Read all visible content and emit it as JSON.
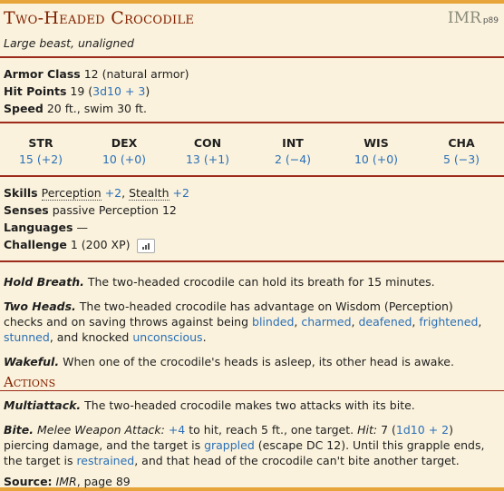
{
  "creature": {
    "name": "Two-Headed Crocodile",
    "source_abbr": "IMR",
    "source_page": "p89",
    "type_line": "Large beast, unaligned"
  },
  "stats": {
    "ac_label": "Armor Class",
    "ac_value": "12 (natural armor)",
    "hp_label": "Hit Points",
    "hp_value": "19 (",
    "hp_dice": "3d10 + 3",
    "hp_close": ")",
    "speed_label": "Speed",
    "speed_value": "20 ft., swim 30 ft."
  },
  "abilities": [
    {
      "name": "STR",
      "score": "15 (+2)"
    },
    {
      "name": "DEX",
      "score": "10 (+0)"
    },
    {
      "name": "CON",
      "score": "13 (+1)"
    },
    {
      "name": "INT",
      "score": "2 (−4)"
    },
    {
      "name": "WIS",
      "score": "10 (+0)"
    },
    {
      "name": "CHA",
      "score": "5 (−3)"
    }
  ],
  "details": {
    "skills_label": "Skills",
    "skill1": "Perception",
    "skill1_bonus": "+2",
    "skill2": "Stealth",
    "skill2_bonus": "+2",
    "senses_label": "Senses",
    "senses_value": "passive Perception 12",
    "languages_label": "Languages",
    "languages_value": "—",
    "challenge_label": "Challenge",
    "challenge_value": "1 (200 XP)"
  },
  "traits": {
    "hold_breath_name": "Hold Breath.",
    "hold_breath_text": "The two-headed crocodile can hold its breath for 15 minutes.",
    "two_heads_name": "Two Heads.",
    "two_heads_text1": "The two-headed crocodile has advantage on Wisdom (Perception) checks and on saving throws against being",
    "cond_blinded": "blinded",
    "cond_charmed": "charmed",
    "cond_deafened": "deafened",
    "cond_frightened": "frightened",
    "cond_stunned": "stunned",
    "and_knocked": ", and knocked",
    "cond_unconscious": "unconscious",
    "wakeful_name": "Wakeful.",
    "wakeful_text": "When one of the crocodile's heads is asleep, its other head is awake."
  },
  "actions": {
    "heading": "Actions",
    "multi_name": "Multiattack.",
    "multi_text": "The two-headed crocodile makes two attacks with its bite.",
    "bite_name": "Bite.",
    "bite_attack": "Melee Weapon Attack:",
    "bite_bonus": "+4",
    "bite_text1": "to hit, reach 5 ft., one target.",
    "bite_hit": "Hit:",
    "bite_dmg": "7 (",
    "bite_dice": "1d10 + 2",
    "bite_text2": ") piercing damage, and the target is",
    "grappled": "grappled",
    "bite_text3": "(escape DC 12). Until this grapple ends, the target is",
    "restrained": "restrained",
    "bite_text4": ", and that head of the crocodile can't bite another target."
  },
  "footer": {
    "source_label": "Source:",
    "source_book": "IMR",
    "source_page": ", page 89"
  }
}
